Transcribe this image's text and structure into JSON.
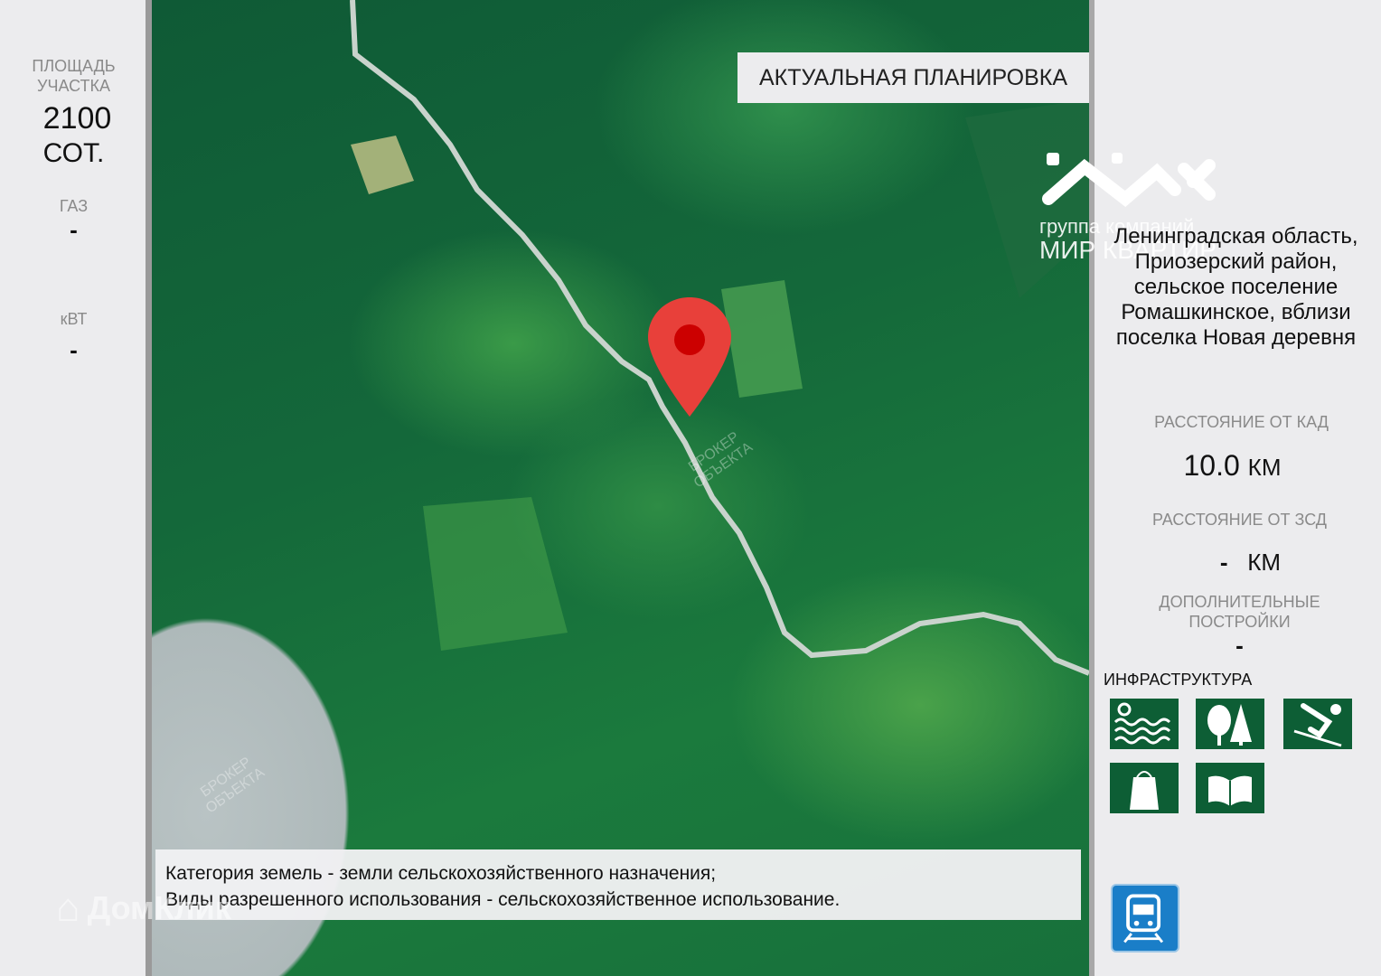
{
  "left_panel": {
    "area_label_line1": "ПЛОЩАДЬ",
    "area_label_line2": "УЧАСТКА",
    "area_value": "2100",
    "area_unit": "СОТ.",
    "gas_label": "ГАЗ",
    "gas_value": "-",
    "power_label": "кВТ",
    "power_value": "-"
  },
  "map": {
    "title": "АКТУАЛЬНАЯ ПЛАНИРОВКА",
    "marker_icon": "map-pin-icon",
    "marker_color": "#e8403a",
    "watermark_text_line1": "БРОКЕР",
    "watermark_text_line2": "ОБЪЕКТА",
    "caption_line1": "Категория земель - земли сельскохозяйственного назначения;",
    "caption_line2": "Виды разрешенного использования - сельскохозяйственное использование.",
    "domclick_watermark": "ДомКлик"
  },
  "logo": {
    "line1": "группа компаний",
    "line2": "МИР КВАРТИР"
  },
  "right_panel": {
    "address": [
      "Ленинградская область,",
      "Приозерский район,",
      "сельское поселение",
      "Ромашкинское, вблизи",
      "поселка Новая деревня"
    ],
    "kad_label": "РАССТОЯНИЕ ОТ КАД",
    "kad_value": "10.0",
    "kad_unit": "КМ",
    "zsd_label": "РАССТОЯНИЕ ОТ ЗСД",
    "zsd_value": "-",
    "zsd_unit": "КМ",
    "extra_label_line1": "ДОПОЛНИТЕЛЬНЫЕ",
    "extra_label_line2": "ПОСТРОЙКИ",
    "extra_value": "-",
    "infra_title": "ИНФРАСТРУКТУРА",
    "infra_icons": [
      "water-icon",
      "forest-icon",
      "skiing-icon",
      "shopping-icon",
      "school-book-icon"
    ],
    "transport_icon": "train-icon",
    "icon_color": "#0d5e35",
    "transport_color": "#1a7ec8"
  }
}
